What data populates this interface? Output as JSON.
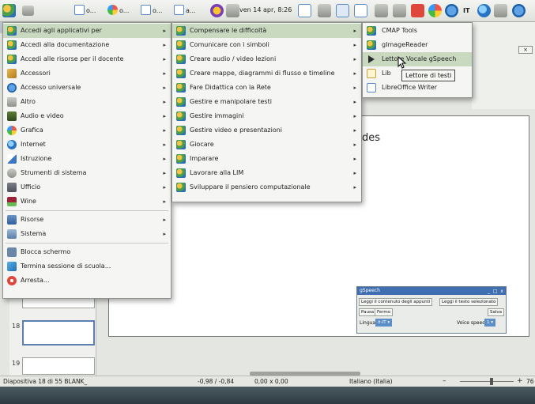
{
  "panel": {
    "tasks": [
      "o...",
      "o...",
      "o...",
      "a..."
    ],
    "clock": "ven 14 apr, 8:26",
    "lang": "IT"
  },
  "menu_main": [
    {
      "label": "Accedi agli applicativi per",
      "arrow": true,
      "icon": "edu-icon",
      "highlight": true
    },
    {
      "label": "Accedi alla documentazione",
      "arrow": true,
      "icon": "edu-icon"
    },
    {
      "label": "Accedi alle risorse per il docente",
      "arrow": true,
      "icon": "edu-icon"
    },
    {
      "label": "Accessori",
      "arrow": true,
      "icon": "accessories-icon"
    },
    {
      "label": "Accesso universale",
      "arrow": true,
      "icon": "accessibility-icon"
    },
    {
      "label": "Altro",
      "arrow": true,
      "icon": "other-icon"
    },
    {
      "label": "Audio e video",
      "arrow": true,
      "icon": "multimedia-icon"
    },
    {
      "label": "Grafica",
      "arrow": true,
      "icon": "graphics-icon"
    },
    {
      "label": "Internet",
      "arrow": true,
      "icon": "internet-icon"
    },
    {
      "label": "Istruzione",
      "arrow": true,
      "icon": "education-icon"
    },
    {
      "label": "Strumenti di sistema",
      "arrow": true,
      "icon": "system-tools-icon"
    },
    {
      "label": "Ufficio",
      "arrow": true,
      "icon": "office-icon"
    },
    {
      "label": "Wine",
      "arrow": true,
      "icon": "wine-icon"
    },
    {
      "label": "Risorse",
      "arrow": true,
      "icon": "resources-icon"
    },
    {
      "label": "Sistema",
      "arrow": true,
      "icon": "system-icon"
    },
    {
      "label": "Blocca schermo",
      "arrow": false,
      "icon": "lock-screen-icon"
    },
    {
      "label": "Termina sessione di scuola...",
      "arrow": false,
      "icon": "logout-icon"
    },
    {
      "label": "Arresta...",
      "arrow": false,
      "icon": "shutdown-icon"
    }
  ],
  "menu_sub": [
    {
      "label": "Compensare le difficoltà",
      "highlight": true
    },
    {
      "label": "Comunicare con i simboli"
    },
    {
      "label": "Creare audio / video lezioni"
    },
    {
      "label": "Creare mappe, diagrammi di flusso e timeline"
    },
    {
      "label": "Fare Didattica con la Rete"
    },
    {
      "label": "Gestire e manipolare testi"
    },
    {
      "label": "Gestire immagini"
    },
    {
      "label": "Gestire video e presentazioni"
    },
    {
      "label": "Giocare"
    },
    {
      "label": "Imparare"
    },
    {
      "label": "Lavorare alla LIM"
    },
    {
      "label": "Sviluppare il pensiero computazionale"
    }
  ],
  "menu_apps": [
    {
      "label": "CMAP Tools",
      "icon": "cmap-icon"
    },
    {
      "label": "gImageReader",
      "icon": "scanner-icon"
    },
    {
      "label": "Lettore Vocale gSpeech",
      "icon": "play-icon",
      "highlight": true
    },
    {
      "label": "Lib",
      "icon": "document-icon"
    },
    {
      "label": "LibreOffice Writer",
      "icon": "writer-icon"
    }
  ],
  "tooltip": "Lettore di testi",
  "slide": {
    "text_fragment": "des"
  },
  "thumbnails": [
    "18",
    "19"
  ],
  "gspeech": {
    "title": "gSpeech",
    "controls": "_ □ x",
    "btn_read_clip": "Leggi il contenuto degli appunti",
    "btn_read_sel": "Leggi il testo selezionato",
    "btn_pause": "Pausa",
    "btn_stop": "Fermo",
    "btn_save": "Salva",
    "lang_label": "Lingua",
    "lang_value": "it-IT",
    "speed_label": "Voice speed",
    "speed_value": "1"
  },
  "statusbar": {
    "slide_info": "Diapositiva 18 di 55  BLANK_",
    "position": "-0,98 / -0,84",
    "size": "0,00 x 0,00",
    "language": "Italiano (Italia)",
    "zoom": "76"
  }
}
